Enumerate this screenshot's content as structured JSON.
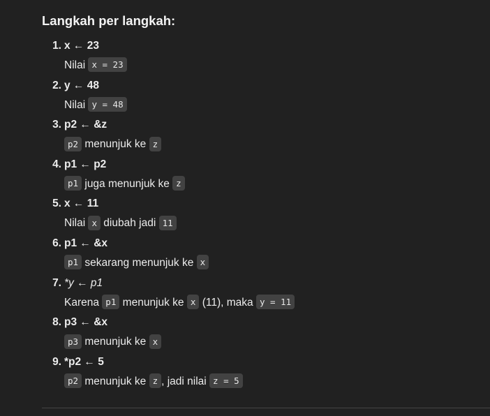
{
  "heading": "Langkah per langkah:",
  "steps": [
    {
      "num": "1.",
      "cmd": "x ← 23",
      "desc": [
        {
          "t": "text",
          "v": "Nilai "
        },
        {
          "t": "code",
          "v": "x = 23"
        }
      ]
    },
    {
      "num": "2.",
      "cmd": "y ← 48",
      "desc": [
        {
          "t": "text",
          "v": "Nilai "
        },
        {
          "t": "code",
          "v": "y = 48"
        }
      ]
    },
    {
      "num": "3.",
      "cmd": "p2 ← &z",
      "desc": [
        {
          "t": "code",
          "v": "p2"
        },
        {
          "t": "text",
          "v": " menunjuk ke "
        },
        {
          "t": "code",
          "v": "z"
        }
      ]
    },
    {
      "num": "4.",
      "cmd": "p1 ← p2",
      "desc": [
        {
          "t": "code",
          "v": "p1"
        },
        {
          "t": "text",
          "v": " juga menunjuk ke "
        },
        {
          "t": "code",
          "v": "z"
        }
      ]
    },
    {
      "num": "5.",
      "cmd": "x ← 11",
      "desc": [
        {
          "t": "text",
          "v": "Nilai "
        },
        {
          "t": "code",
          "v": "x"
        },
        {
          "t": "text",
          "v": " diubah jadi "
        },
        {
          "t": "code",
          "v": "11"
        }
      ]
    },
    {
      "num": "6.",
      "cmd": "p1 ← &x",
      "desc": [
        {
          "t": "code",
          "v": "p1"
        },
        {
          "t": "text",
          "v": " sekarang menunjuk ke "
        },
        {
          "t": "code",
          "v": "x"
        }
      ]
    },
    {
      "num": "7.",
      "cmd": "*y ← p1",
      "italic": true,
      "desc": [
        {
          "t": "text",
          "v": "Karena "
        },
        {
          "t": "code",
          "v": "p1"
        },
        {
          "t": "text",
          "v": " menunjuk ke "
        },
        {
          "t": "code",
          "v": "x"
        },
        {
          "t": "text",
          "v": " (11), maka "
        },
        {
          "t": "code",
          "v": "y = 11"
        }
      ]
    },
    {
      "num": "8.",
      "cmd": "p3 ← &x",
      "desc": [
        {
          "t": "code",
          "v": "p3"
        },
        {
          "t": "text",
          "v": " menunjuk ke "
        },
        {
          "t": "code",
          "v": "x"
        }
      ]
    },
    {
      "num": "9.",
      "cmd": "*p2 ← 5",
      "desc": [
        {
          "t": "code",
          "v": "p2"
        },
        {
          "t": "text",
          "v": " menunjuk ke "
        },
        {
          "t": "code",
          "v": "z"
        },
        {
          "t": "text",
          "v": ", jadi nilai "
        },
        {
          "t": "code",
          "v": "z = 5"
        }
      ]
    }
  ]
}
